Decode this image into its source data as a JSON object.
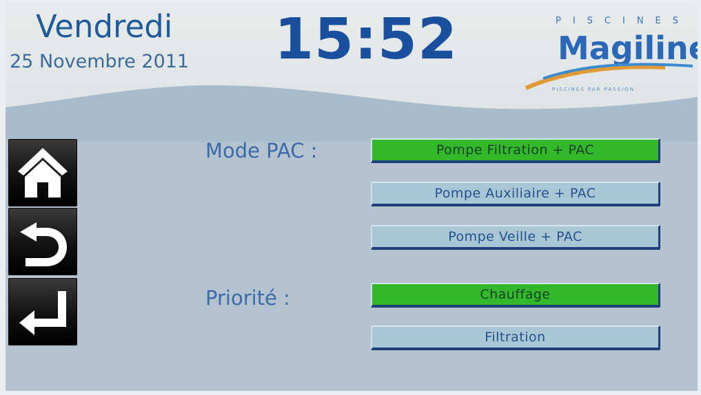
{
  "header": {
    "day": "Vendredi",
    "date": "25 Novembre 2011",
    "time": "15:52"
  },
  "logo": {
    "top_text": "PISCINES",
    "brand": "Magiline",
    "tagline": "PISCINES PAR PASSION"
  },
  "nav": {
    "home_icon": "home-icon",
    "back_icon": "undo-arrow-icon",
    "enter_icon": "enter-arrow-icon"
  },
  "mode": {
    "label": "Mode PAC :",
    "options": [
      {
        "label": "Pompe Filtration + PAC",
        "selected": true
      },
      {
        "label": "Pompe Auxiliaire + PAC",
        "selected": false
      },
      {
        "label": "Pompe Veille + PAC",
        "selected": false
      }
    ]
  },
  "priority": {
    "label": "Priorité :",
    "options": [
      {
        "label": "Chauffage",
        "selected": true
      },
      {
        "label": "Filtration",
        "selected": false
      }
    ]
  },
  "colors": {
    "selected": "#33b82c",
    "unselected": "#a8c6d4",
    "accent": "#1a4f9e"
  }
}
